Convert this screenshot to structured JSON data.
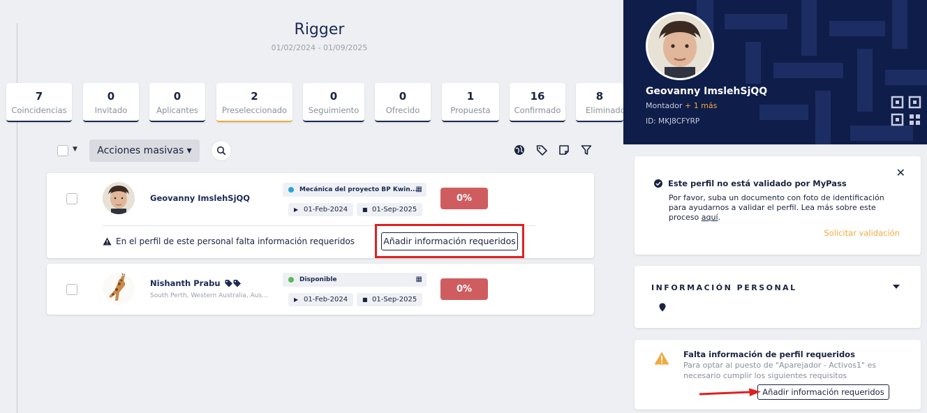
{
  "job": {
    "title": "Rigger",
    "date_range": "01/02/2024 - 01/09/2025"
  },
  "stats": [
    {
      "count": "7",
      "label": "Coincidencias"
    },
    {
      "count": "0",
      "label": "Invitado"
    },
    {
      "count": "0",
      "label": "Aplicantes"
    },
    {
      "count": "2",
      "label": "Preseleccionado",
      "active": true
    },
    {
      "count": "0",
      "label": "Seguimiento"
    },
    {
      "count": "0",
      "label": "Ofrecido"
    },
    {
      "count": "1",
      "label": "Propuesta"
    },
    {
      "count": "16",
      "label": "Confirmado"
    },
    {
      "count": "8",
      "label": "Eliminado"
    }
  ],
  "toolbar": {
    "bulk_actions_label": "Acciones masivas ▾",
    "icons": [
      "globe-icon",
      "tag-icon",
      "note-icon",
      "filter-icon"
    ]
  },
  "candidates": [
    {
      "name": "Geovanny ImslehSjQQ",
      "location": "",
      "status": "Mecánica del proyecto BP Kwin...",
      "status_color": "#2aa4d8",
      "start_date": "01-Feb-2024",
      "end_date": "01-Sep-2025",
      "match": "0%",
      "warning": "En el perfil de este personal falta información requeridos",
      "action_label": "Añadir información requeridos"
    },
    {
      "name": "Nishanth Prabu",
      "location": "South Perth, Western Australia, Aus...",
      "status": "Disponible",
      "status_color": "#5cb85c",
      "start_date": "01-Feb-2024",
      "end_date": "01-Sep-2025",
      "match": "0%"
    }
  ],
  "profile": {
    "name": "Geovanny ImslehSjQQ",
    "role": "Montador",
    "role_more": "+ 1 más",
    "id": "ID: MKJ8CFYRP"
  },
  "validation": {
    "title": "Este perfil no está validado por MyPass",
    "body_pre": "Por favor, suba un documento con foto de identificación para ayudarnos a validar el perfil. Lea más sobre este proceso ",
    "body_link": "aquí",
    "body_post": ".",
    "action": "Solicitar validación"
  },
  "personal_info": {
    "title": "INFORMACIÓN PERSONAL"
  },
  "missing_info": {
    "title": "Falta información de perfil requeridos",
    "body": "Para optar al puesto de \"Aparejador - Activos1\" es necesario cumplir los siguientes requisitos",
    "action": "Añadir información requeridos"
  },
  "colors": {
    "navy": "#0f1d4a",
    "accent": "#f2a93b",
    "danger": "#cf5d5f",
    "highlight": "#e0201f"
  }
}
